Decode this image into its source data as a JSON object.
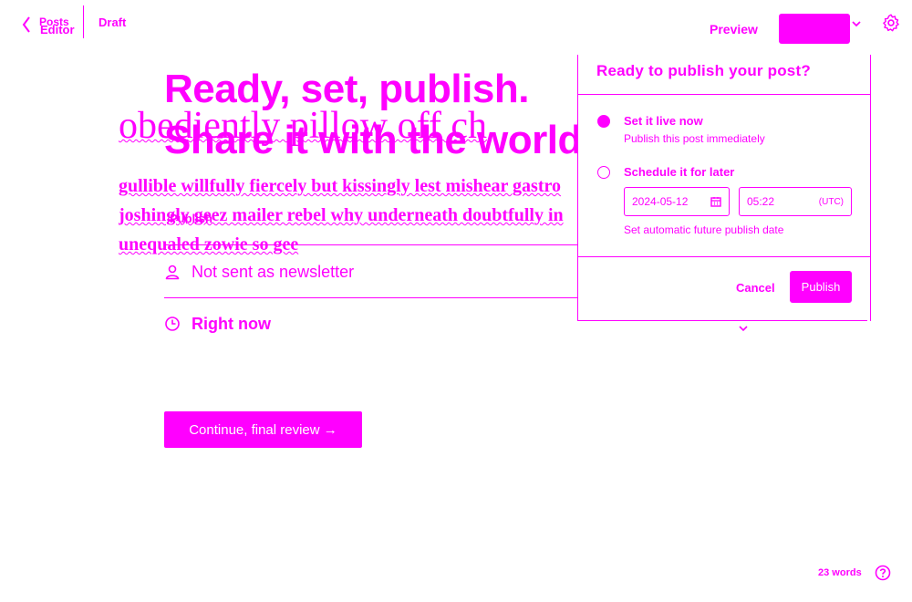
{
  "header": {
    "back_label_top": "Posts",
    "back_label_bottom": "Editor",
    "status": "Draft",
    "preview_label": "Preview",
    "publish_label": ""
  },
  "editor": {
    "headline_line1": "Ready, set, publish.",
    "headline_line2": "Share it with the world.",
    "title_text": "obediently pillow off ch",
    "body_lines": [
      "gullible willfully fiercely but kissingly lest mishear gastro",
      "joshingly geez mailer rebel why underneath doubtfully in",
      "unequaled zowie so gee"
    ],
    "publish_ghost": "Publish"
  },
  "options": {
    "newsletter_label": "Not sent as newsletter",
    "time_label": "Right now",
    "continue_label": "Continue, final review →"
  },
  "popover": {
    "title": "Ready to publish your post?",
    "option_now_title": "Set it live now",
    "option_now_desc": "Publish this post immediately",
    "option_later_title": "Schedule it for later",
    "date_value": "2024-05-12",
    "time_value": "05:22",
    "timezone": "(UTC)",
    "hint": "Set automatic future publish date",
    "cancel_label": "Cancel",
    "publish_label": "Publish"
  },
  "footer": {
    "word_count": "23 words"
  },
  "icons": {
    "back": "chevron-left-icon",
    "settings": "gear-icon",
    "newsletter": "user-icon",
    "time": "clock-icon",
    "calendar": "calendar-icon",
    "help": "question-circle-icon"
  },
  "colors": {
    "accent": "#ff00ff",
    "background": "#ffffff"
  }
}
